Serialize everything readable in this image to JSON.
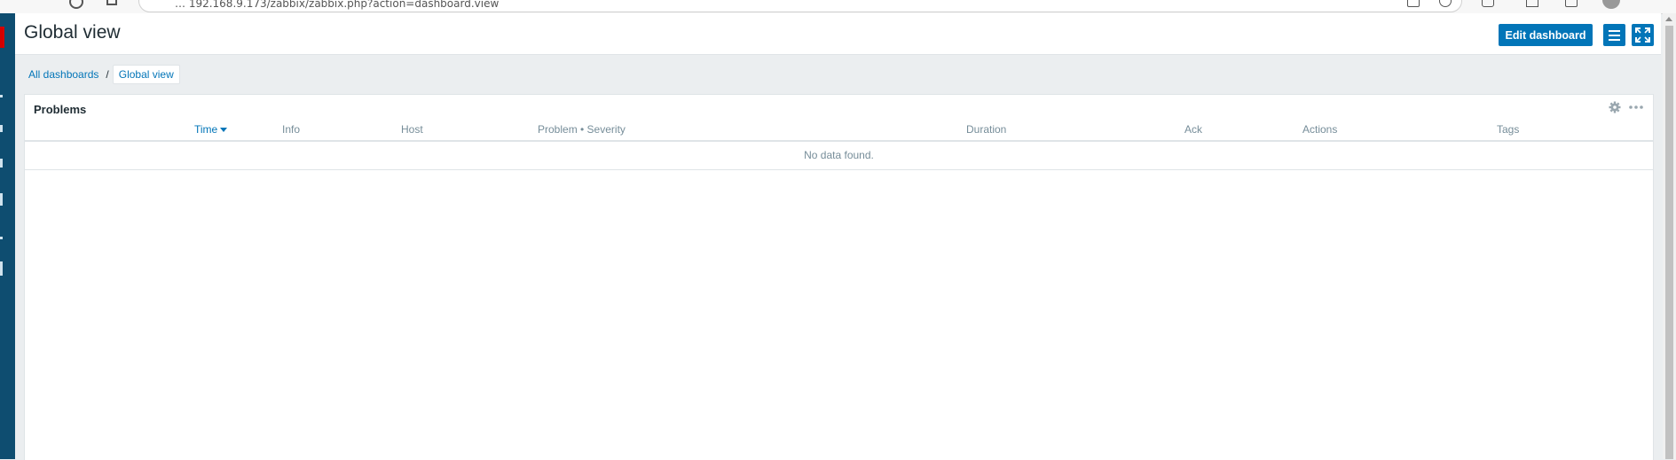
{
  "browser": {
    "url_text": "… 192.168.9.173/zabbix/zabbix.php?action=dashboard.view"
  },
  "header": {
    "title": "Global view",
    "edit_button": "Edit dashboard"
  },
  "breadcrumb": {
    "items": [
      "All dashboards",
      "Global view"
    ],
    "separator": "/"
  },
  "widget": {
    "title": "Problems",
    "columns": [
      "Time",
      "Info",
      "Host",
      "Problem • Severity",
      "Duration",
      "Ack",
      "Actions",
      "Tags"
    ],
    "sorted_column": "Time",
    "sort_direction": "desc",
    "empty_message": "No data found."
  },
  "colors": {
    "accent": "#0275b8",
    "sidebar": "#0e4d70",
    "logo": "#d40000",
    "page_bg": "#ebeef0"
  }
}
